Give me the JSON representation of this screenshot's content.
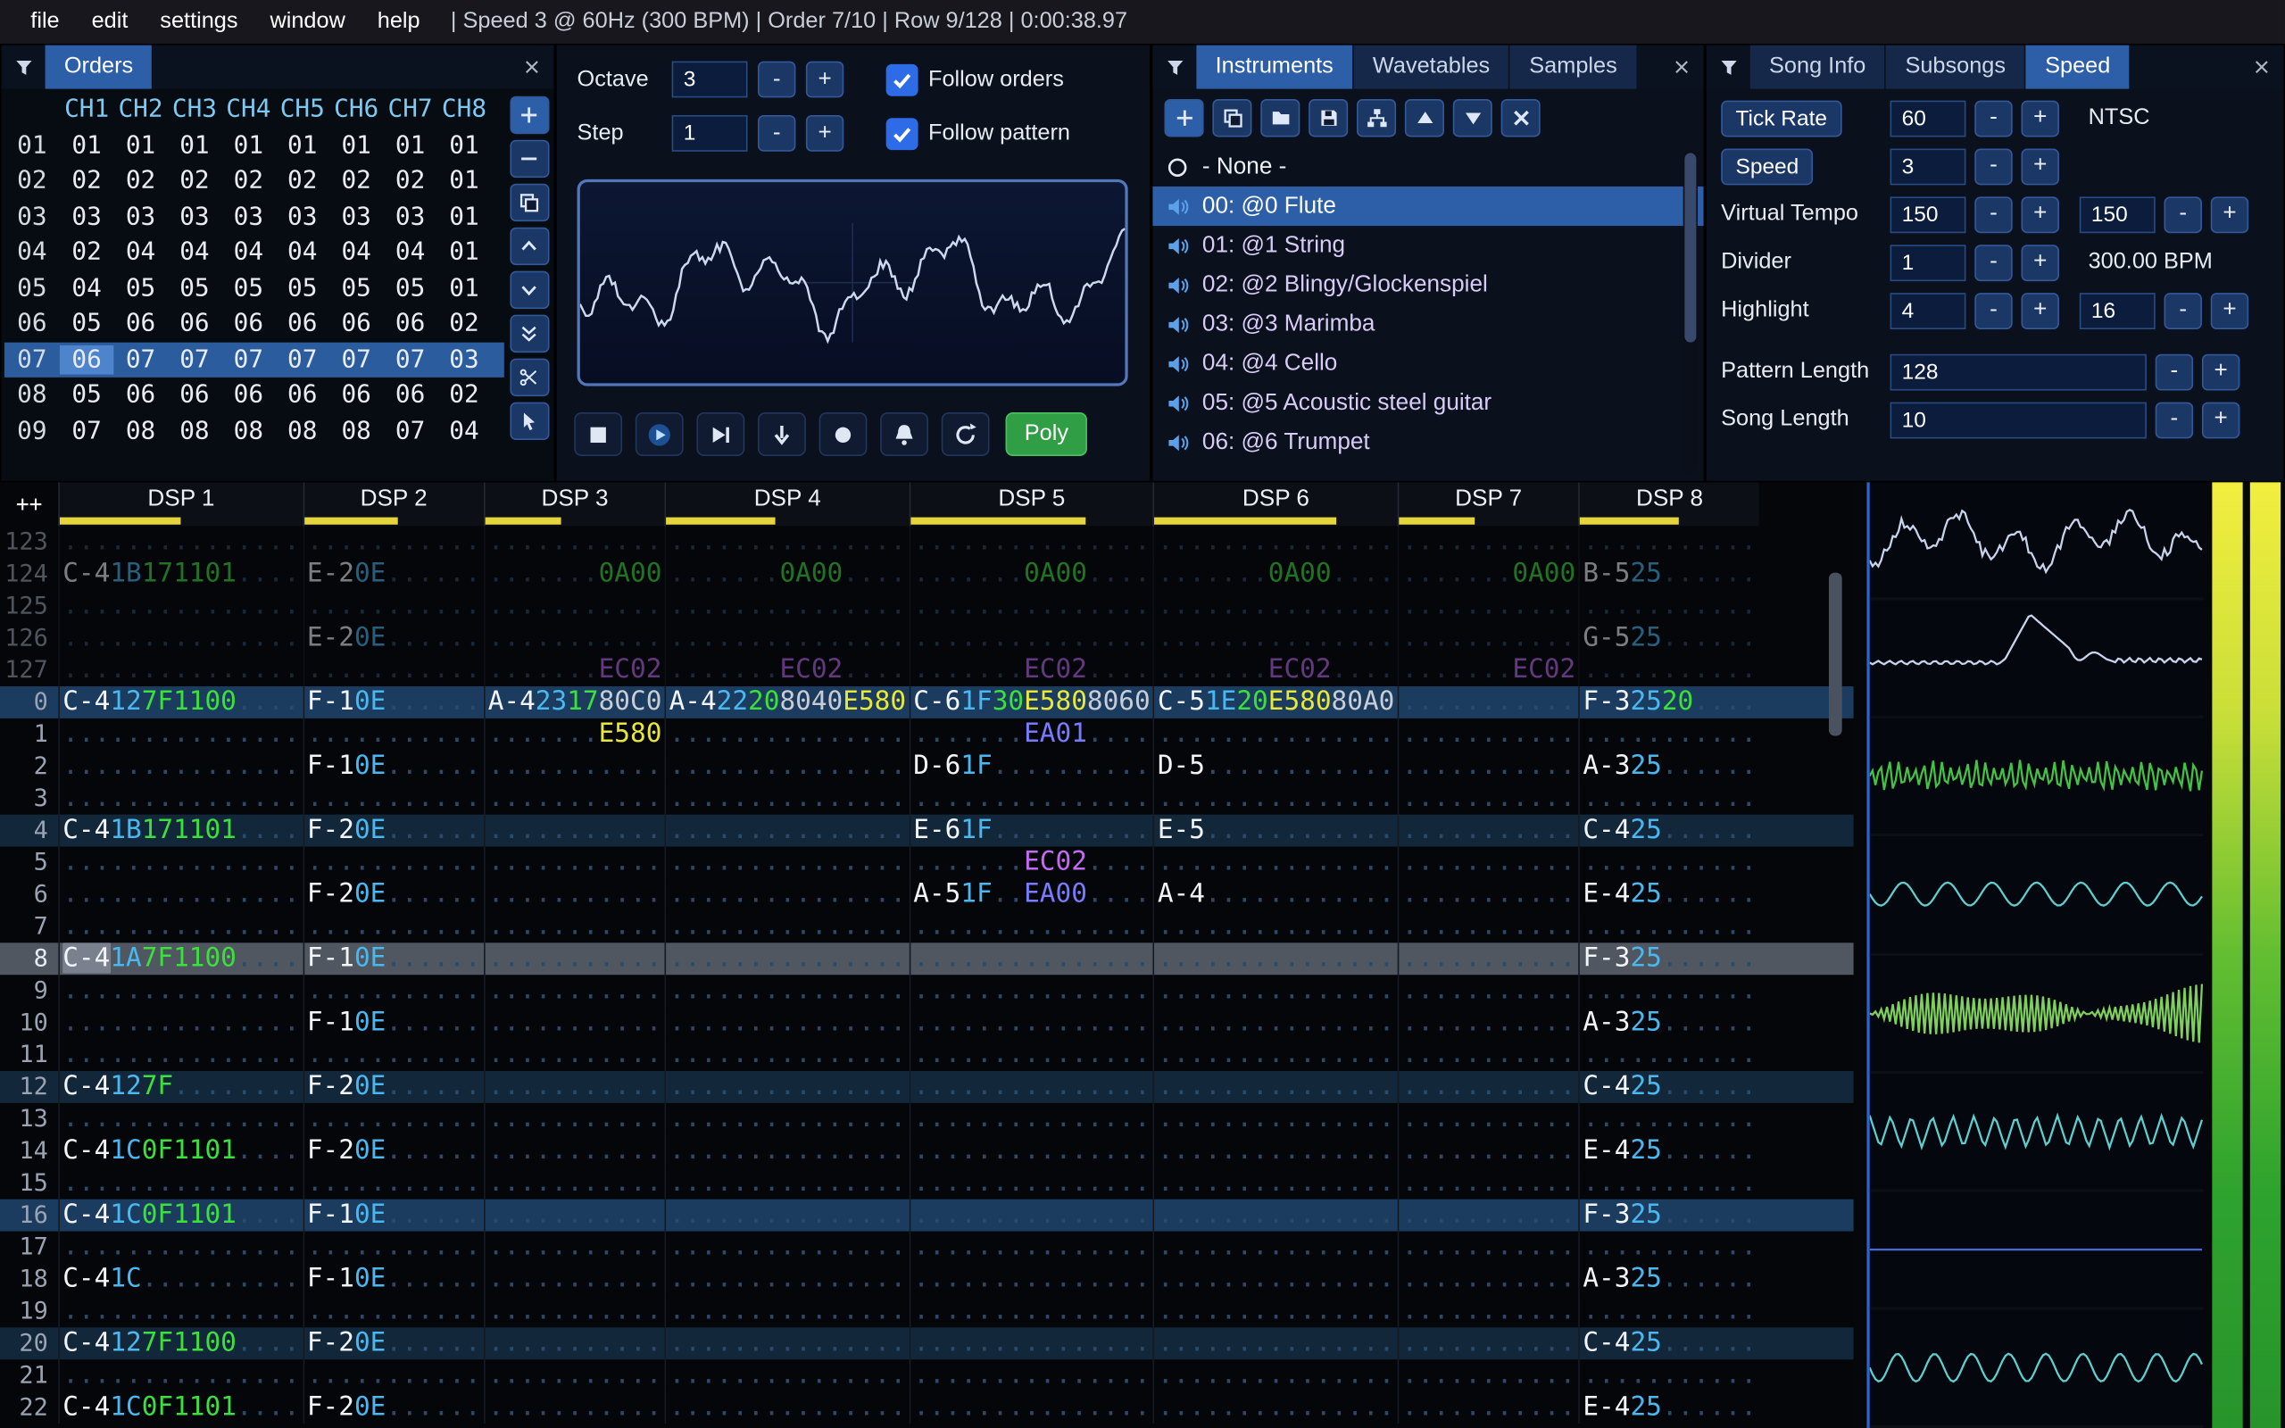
{
  "ui": {
    "minus": "-",
    "plus": "+"
  },
  "menu": {
    "items": [
      "file",
      "edit",
      "settings",
      "window",
      "help"
    ],
    "status": "| Speed 3 @ 60Hz (300 BPM) | Order 7/10 | Row 9/128 | 0:00:38.97"
  },
  "orders": {
    "title": "Orders",
    "col_headers": [
      "CH1",
      "CH2",
      "CH3",
      "CH4",
      "CH5",
      "CH6",
      "CH7",
      "CH8"
    ],
    "rows": [
      {
        "num": "01",
        "vals": [
          "01",
          "01",
          "01",
          "01",
          "01",
          "01",
          "01",
          "01"
        ]
      },
      {
        "num": "02",
        "vals": [
          "02",
          "02",
          "02",
          "02",
          "02",
          "02",
          "02",
          "01"
        ]
      },
      {
        "num": "03",
        "vals": [
          "03",
          "03",
          "03",
          "03",
          "03",
          "03",
          "03",
          "01"
        ]
      },
      {
        "num": "04",
        "vals": [
          "02",
          "04",
          "04",
          "04",
          "04",
          "04",
          "04",
          "01"
        ]
      },
      {
        "num": "05",
        "vals": [
          "04",
          "05",
          "05",
          "05",
          "05",
          "05",
          "05",
          "01"
        ]
      },
      {
        "num": "06",
        "vals": [
          "05",
          "06",
          "06",
          "06",
          "06",
          "06",
          "06",
          "02"
        ]
      },
      {
        "num": "07",
        "vals": [
          "06",
          "07",
          "07",
          "07",
          "07",
          "07",
          "07",
          "03"
        ],
        "selected": true
      },
      {
        "num": "08",
        "vals": [
          "05",
          "06",
          "06",
          "06",
          "06",
          "06",
          "06",
          "02"
        ]
      },
      {
        "num": "09",
        "vals": [
          "07",
          "08",
          "08",
          "08",
          "08",
          "08",
          "07",
          "04"
        ]
      }
    ],
    "toolbar": [
      {
        "name": "add-order-button",
        "icon": "plus"
      },
      {
        "name": "remove-order-button",
        "icon": "minus"
      },
      {
        "name": "duplicate-order-button",
        "icon": "copy"
      },
      {
        "name": "move-order-up-button",
        "icon": "chevron-up"
      },
      {
        "name": "move-order-down-button",
        "icon": "chevron-down"
      },
      {
        "name": "duplicate-order-end-button",
        "icon": "double-chevron-down"
      },
      {
        "name": "order-shuffle-button",
        "icon": "scissors"
      },
      {
        "name": "order-change-mode-button",
        "icon": "pointer"
      }
    ]
  },
  "controls": {
    "octave_label": "Octave",
    "octave": "3",
    "step_label": "Step",
    "step": "1",
    "follow_orders": "Follow orders",
    "follow_pattern": "Follow pattern",
    "poly_label": "Poly",
    "transport": [
      {
        "name": "stop-button",
        "icon": "stop"
      },
      {
        "name": "play-button",
        "icon": "play"
      },
      {
        "name": "play-from-cursor-button",
        "icon": "play-next"
      },
      {
        "name": "step-row-button",
        "icon": "arrow-down"
      },
      {
        "name": "record-button",
        "icon": "record"
      },
      {
        "name": "metronome-button",
        "icon": "bell"
      },
      {
        "name": "repeat-pattern-button",
        "icon": "repeat"
      }
    ]
  },
  "instruments": {
    "tabs": [
      "Instruments",
      "Wavetables",
      "Samples"
    ],
    "toolbar": [
      {
        "name": "add-instrument-button",
        "icon": "plus"
      },
      {
        "name": "duplicate-instrument-button",
        "icon": "copy"
      },
      {
        "name": "open-instrument-button",
        "icon": "folder"
      },
      {
        "name": "save-instrument-button",
        "icon": "floppy"
      },
      {
        "name": "instrument-hierarchy-button",
        "icon": "sitemap"
      },
      {
        "name": "move-instrument-up-button",
        "icon": "triangle-up"
      },
      {
        "name": "move-instrument-down-button",
        "icon": "triangle-down"
      },
      {
        "name": "delete-instrument-button",
        "icon": "x"
      }
    ],
    "items": [
      {
        "label": "- None -",
        "icon": "circle"
      },
      {
        "label": "00: @0 Flute",
        "icon": "speaker",
        "selected": true
      },
      {
        "label": "01: @1 String",
        "icon": "speaker"
      },
      {
        "label": "02: @2 Blingy/Glockenspiel",
        "icon": "speaker"
      },
      {
        "label": "03: @3 Marimba",
        "icon": "speaker"
      },
      {
        "label": "04: @4 Cello",
        "icon": "speaker"
      },
      {
        "label": "05: @5 Acoustic steel guitar",
        "icon": "speaker"
      },
      {
        "label": "06: @6 Trumpet",
        "icon": "speaker"
      }
    ]
  },
  "song": {
    "tabs": [
      "Song Info",
      "Subsongs",
      "Speed"
    ],
    "tick_rate_label": "Tick Rate",
    "tick_rate": "60",
    "tick_mode": "NTSC",
    "speed_label": "Speed",
    "speed": "3",
    "virtual_tempo_label": "Virtual Tempo",
    "virtual_tempo_num": "150",
    "virtual_tempo_den": "150",
    "divider_label": "Divider",
    "divider": "1",
    "bpm": "300.00 BPM",
    "highlight_label": "Highlight",
    "highlight_a": "4",
    "highlight_b": "16",
    "pattern_length_label": "Pattern Length",
    "pattern_length": "128",
    "song_length_label": "Song Length",
    "song_length": "10"
  },
  "pattern": {
    "expand_label": "++",
    "channels": [
      {
        "name": "DSP 1",
        "fx": 2,
        "meter": 0.5
      },
      {
        "name": "DSP 2",
        "fx": 1,
        "meter": 0.52
      },
      {
        "name": "DSP 3",
        "fx": 1,
        "meter": 0.42
      },
      {
        "name": "DSP 4",
        "fx": 2,
        "meter": 0.45
      },
      {
        "name": "DSP 5",
        "fx": 2,
        "meter": 0.72
      },
      {
        "name": "DSP 6",
        "fx": 2,
        "meter": 0.75
      },
      {
        "name": "DSP 7",
        "fx": 1,
        "meter": 0.42
      },
      {
        "name": "DSP 8",
        "fx": 1,
        "meter": 0.55
      }
    ],
    "rows": [
      {
        "num": "123",
        "type": "prev",
        "cells": [
          null,
          null,
          null,
          null,
          null,
          null,
          null,
          null
        ]
      },
      {
        "num": "124",
        "type": "prev",
        "cells": [
          [
            "C-4",
            "1B",
            "17",
            "1101",
            ""
          ],
          [
            "E-2",
            "0E",
            "",
            ""
          ],
          [
            "",
            "",
            "",
            "0A00"
          ],
          [
            "",
            "",
            "",
            "0A00",
            ""
          ],
          [
            "",
            "",
            "",
            "0A00",
            ""
          ],
          [
            "",
            "",
            "",
            "0A00",
            ""
          ],
          [
            "",
            "",
            "",
            "0A00"
          ],
          [
            "B-5",
            "25",
            "",
            ""
          ]
        ]
      },
      {
        "num": "125",
        "type": "prev",
        "cells": [
          null,
          null,
          null,
          null,
          null,
          null,
          null,
          null
        ]
      },
      {
        "num": "126",
        "type": "prev",
        "cells": [
          null,
          [
            "E-2",
            "0E",
            "",
            ""
          ],
          null,
          null,
          null,
          null,
          null,
          [
            "G-5",
            "25",
            "",
            ""
          ]
        ]
      },
      {
        "num": "127",
        "type": "prev",
        "cells": [
          null,
          null,
          [
            "",
            "",
            "",
            "EC02"
          ],
          [
            "",
            "",
            "",
            "EC02",
            ""
          ],
          [
            "",
            "",
            "",
            "EC02",
            ""
          ],
          [
            "",
            "",
            "",
            "EC02",
            ""
          ],
          [
            "",
            "",
            "",
            "EC02"
          ],
          null
        ]
      },
      {
        "num": "0",
        "type": "major",
        "cells": [
          [
            "C-4",
            "12",
            "7F",
            "1100",
            ""
          ],
          [
            "F-1",
            "0E",
            "",
            ""
          ],
          [
            "A-4",
            "23",
            "17",
            "80C0"
          ],
          [
            "A-4",
            "22",
            "20",
            "8040",
            "E580"
          ],
          [
            "C-6",
            "1F",
            "30",
            "E580",
            "8060"
          ],
          [
            "C-5",
            "1E",
            "20",
            "E580",
            "80A0"
          ],
          null,
          [
            "F-3",
            "25",
            "20",
            ""
          ]
        ]
      },
      {
        "num": "1",
        "type": "",
        "cells": [
          null,
          null,
          [
            "",
            "",
            "",
            "E580"
          ],
          null,
          [
            "",
            "",
            "",
            "EA01",
            ""
          ],
          null,
          null,
          null
        ]
      },
      {
        "num": "2",
        "type": "",
        "cells": [
          null,
          [
            "F-1",
            "0E",
            "",
            ""
          ],
          null,
          null,
          [
            "D-6",
            "1F",
            "",
            "",
            ""
          ],
          [
            "D-5",
            "",
            "",
            "",
            ""
          ],
          null,
          [
            "A-3",
            "25",
            "",
            ""
          ]
        ]
      },
      {
        "num": "3",
        "type": "",
        "cells": [
          null,
          null,
          null,
          null,
          null,
          null,
          null,
          null
        ]
      },
      {
        "num": "4",
        "type": "minor",
        "cells": [
          [
            "C-4",
            "1B",
            "17",
            "1101",
            ""
          ],
          [
            "F-2",
            "0E",
            "",
            ""
          ],
          null,
          null,
          [
            "E-6",
            "1F",
            "",
            "",
            ""
          ],
          [
            "E-5",
            "",
            "",
            "",
            ""
          ],
          null,
          [
            "C-4",
            "25",
            "",
            ""
          ]
        ]
      },
      {
        "num": "5",
        "type": "",
        "cells": [
          null,
          null,
          null,
          null,
          [
            "",
            "",
            "",
            "EC02",
            ""
          ],
          null,
          null,
          null
        ]
      },
      {
        "num": "6",
        "type": "",
        "cells": [
          null,
          [
            "F-2",
            "0E",
            "",
            ""
          ],
          null,
          null,
          [
            "A-5",
            "1F",
            "",
            "EA00",
            ""
          ],
          [
            "A-4",
            "",
            "",
            "",
            ""
          ],
          null,
          [
            "E-4",
            "25",
            "",
            ""
          ]
        ]
      },
      {
        "num": "7",
        "type": "",
        "cells": [
          null,
          null,
          null,
          null,
          null,
          null,
          null,
          null
        ]
      },
      {
        "num": "8",
        "type": "play",
        "cursor": 0,
        "cells": [
          [
            "C-4",
            "1A",
            "7F",
            "1100",
            ""
          ],
          [
            "F-1",
            "0E",
            "",
            ""
          ],
          null,
          null,
          null,
          null,
          null,
          [
            "F-3",
            "25",
            "",
            ""
          ]
        ]
      },
      {
        "num": "9",
        "type": "",
        "cells": [
          null,
          null,
          null,
          null,
          null,
          null,
          null,
          null
        ]
      },
      {
        "num": "10",
        "type": "",
        "cells": [
          null,
          [
            "F-1",
            "0E",
            "",
            ""
          ],
          null,
          null,
          null,
          null,
          null,
          [
            "A-3",
            "25",
            "",
            ""
          ]
        ]
      },
      {
        "num": "11",
        "type": "",
        "cells": [
          null,
          null,
          null,
          null,
          null,
          null,
          null,
          null
        ]
      },
      {
        "num": "12",
        "type": "minor",
        "cells": [
          [
            "C-4",
            "12",
            "7F",
            "",
            ""
          ],
          [
            "F-2",
            "0E",
            "",
            ""
          ],
          null,
          null,
          null,
          null,
          null,
          [
            "C-4",
            "25",
            "",
            ""
          ]
        ]
      },
      {
        "num": "13",
        "type": "",
        "cells": [
          null,
          null,
          null,
          null,
          null,
          null,
          null,
          null
        ]
      },
      {
        "num": "14",
        "type": "",
        "cells": [
          [
            "C-4",
            "1C",
            "0F",
            "1101",
            ""
          ],
          [
            "F-2",
            "0E",
            "",
            ""
          ],
          null,
          null,
          null,
          null,
          null,
          [
            "E-4",
            "25",
            "",
            ""
          ]
        ]
      },
      {
        "num": "15",
        "type": "",
        "cells": [
          null,
          null,
          null,
          null,
          null,
          null,
          null,
          null
        ]
      },
      {
        "num": "16",
        "type": "major",
        "cells": [
          [
            "C-4",
            "1C",
            "0F",
            "1101",
            ""
          ],
          [
            "F-1",
            "0E",
            "",
            ""
          ],
          null,
          null,
          null,
          null,
          null,
          [
            "F-3",
            "25",
            "",
            ""
          ]
        ]
      },
      {
        "num": "17",
        "type": "",
        "cells": [
          null,
          null,
          null,
          null,
          null,
          null,
          null,
          null
        ]
      },
      {
        "num": "18",
        "type": "",
        "cells": [
          [
            "C-4",
            "1C",
            "",
            "",
            ""
          ],
          [
            "F-1",
            "0E",
            "",
            ""
          ],
          null,
          null,
          null,
          null,
          null,
          [
            "A-3",
            "25",
            "",
            ""
          ]
        ]
      },
      {
        "num": "19",
        "type": "",
        "cells": [
          null,
          null,
          null,
          null,
          null,
          null,
          null,
          null
        ]
      },
      {
        "num": "20",
        "type": "minor",
        "cells": [
          [
            "C-4",
            "12",
            "7F",
            "1100",
            ""
          ],
          [
            "F-2",
            "0E",
            "",
            ""
          ],
          null,
          null,
          null,
          null,
          null,
          [
            "C-4",
            "25",
            "",
            ""
          ]
        ]
      },
      {
        "num": "21",
        "type": "",
        "cells": [
          null,
          null,
          null,
          null,
          null,
          null,
          null,
          null
        ]
      },
      {
        "num": "22",
        "type": "",
        "cells": [
          [
            "C-4",
            "1C",
            "0F",
            "1101",
            ""
          ],
          [
            "F-2",
            "0E",
            "",
            ""
          ],
          null,
          null,
          null,
          null,
          null,
          [
            "E-4",
            "25",
            "",
            ""
          ]
        ]
      }
    ]
  },
  "colors": {
    "accent": "#2d5fa8",
    "note": "#f2f4f8",
    "ins": "#4ab8f0",
    "vol": "#3ce03c",
    "dots": "#2b4a68",
    "effects": {
      "0A": "#3ce03c",
      "11": "#3ce03c",
      "E5": "#e8e838",
      "EA": "#7a7aff",
      "EC": "#c46af2",
      "80": "#c8ccd4"
    },
    "channel_meter": "#e6d43c",
    "osc_main": "#cdd9ee"
  },
  "scopes": [
    {
      "kind": "noise",
      "color": "#c7d4ec"
    },
    {
      "kind": "pulse",
      "color": "#c7d4ec"
    },
    {
      "kind": "dense",
      "color": "#44c244"
    },
    {
      "kind": "sine",
      "color": "#5ecfcf"
    },
    {
      "kind": "dense2",
      "color": "#7ed05a"
    },
    {
      "kind": "zigzag",
      "color": "#5ecfcf"
    },
    {
      "kind": "flat",
      "color": "#4668d8"
    },
    {
      "kind": "sine2",
      "color": "#5ecfcf"
    }
  ],
  "meter": {
    "bars": [
      "left",
      "right"
    ],
    "gradient": [
      "#f2ee3e",
      "#c8de38",
      "#63be31",
      "#2ea32e",
      "#27942b"
    ]
  }
}
